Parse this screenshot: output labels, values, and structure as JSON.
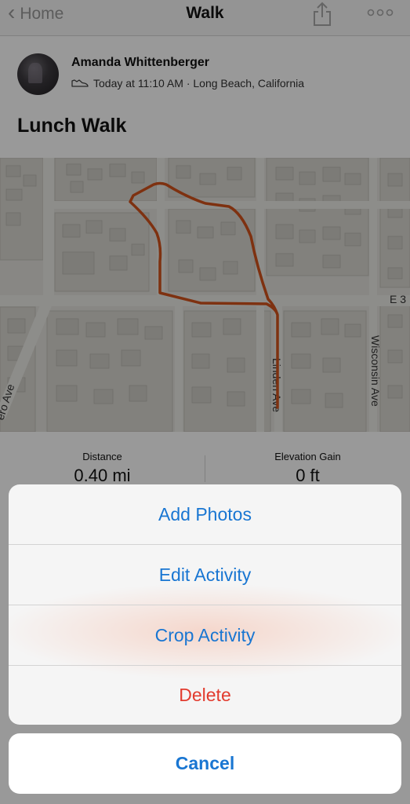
{
  "nav": {
    "back_label": "Home",
    "title": "Walk",
    "share_icon": "share-icon",
    "more_icon": "more-icon"
  },
  "author": {
    "name": "Amanda Whittenberger",
    "meta": "Today at 11:10 AM · Long Beach, California",
    "activity_icon": "shoe-icon"
  },
  "activity": {
    "title": "Lunch Walk"
  },
  "map": {
    "street_labels": [
      "E 3",
      "Wisconsin Ave",
      "Linden Ave",
      "ero Ave"
    ],
    "route_color": "#d2521c"
  },
  "stats": [
    {
      "label": "Distance",
      "value": "0.40 mi"
    },
    {
      "label": "Elevation Gain",
      "value": "0 ft"
    }
  ],
  "action_sheet": {
    "options": [
      {
        "label": "Add Photos"
      },
      {
        "label": "Edit Activity"
      },
      {
        "label": "Crop Activity"
      },
      {
        "label": "Delete"
      }
    ],
    "cancel_label": "Cancel"
  },
  "colors": {
    "accent": "#1976d2",
    "destructive": "#e23b2e"
  }
}
